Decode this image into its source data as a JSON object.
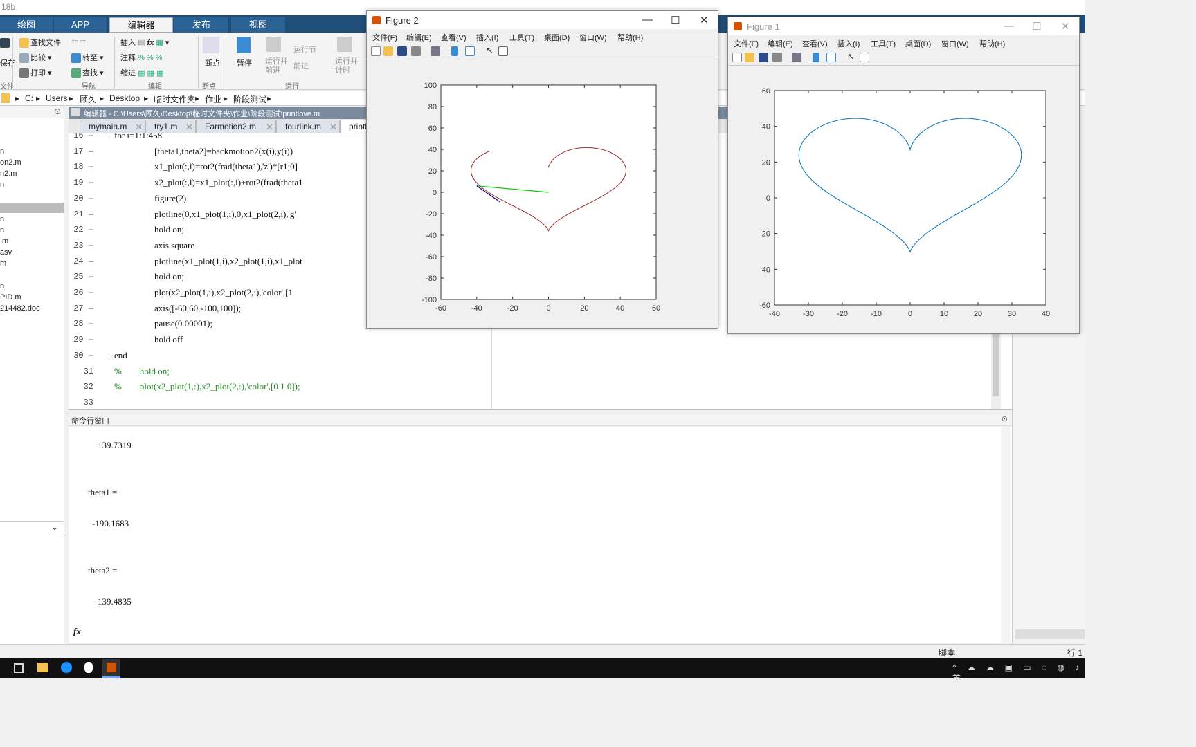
{
  "app": {
    "title_fragment": "18b"
  },
  "ribbon_tabs": [
    "绘图",
    "APP",
    "编辑器",
    "发布",
    "视图"
  ],
  "ribbon": {
    "file_group": {
      "save": "保存",
      "label": "文件"
    },
    "edit": {
      "find_files": "查找文件",
      "compare": "比较",
      "print": "打印",
      "goto": "转至",
      "find": "查找",
      "nav_label": "导航"
    },
    "editor": {
      "insert": "插入",
      "comment": "注释",
      "indent": "缩进",
      "fx": "fx",
      "label": "编辑"
    },
    "breakpoints": {
      "label": "断点",
      "btn": "断点"
    },
    "run": {
      "pause": "暂停",
      "run_advance": "运行并\n前进",
      "run_section": "运行节",
      "advance": "前进",
      "run_time": "运行并\n计时",
      "label": "运行"
    }
  },
  "address": [
    "C:",
    "Users",
    "顾久",
    "Desktop",
    "临时文件夹",
    "作业",
    "阶段测试"
  ],
  "left_files": [
    "n",
    "on2.m",
    "n2.m",
    "n",
    "",
    "n",
    "n",
    ".m",
    "asv",
    "m",
    "",
    "n",
    "PID.m",
    "214482.doc"
  ],
  "editor": {
    "header": "编辑器 - C:\\Users\\顾久\\Desktop\\临时文件夹\\作业\\阶段测试\\printlove.m",
    "tabs": [
      "mymain.m",
      "try1.m",
      "Farmotion2.m",
      "fourlink.m",
      "printlove.m"
    ],
    "lines": [
      {
        "n": "16 —",
        "text": "for i=1:1:458",
        "indent": 0
      },
      {
        "n": "17 —",
        "text": "[theta1,theta2]=backmotion2(x(i),y(i))",
        "indent": 1
      },
      {
        "n": "18 —",
        "text": "x1_plot(:,i)=rot2(frad(theta1),'z')*[r1;0]",
        "indent": 1
      },
      {
        "n": "19 —",
        "text": "x2_plot(:,i)=x1_plot(:,i)+rot2(frad(theta1",
        "indent": 1
      },
      {
        "n": "20 —",
        "text": "figure(2)",
        "indent": 1
      },
      {
        "n": "21 —",
        "text": "plotline(0,x1_plot(1,i),0,x1_plot(2,i),'g'",
        "indent": 1
      },
      {
        "n": "22 —",
        "text": "hold on;",
        "indent": 1
      },
      {
        "n": "23 —",
        "text": "axis square",
        "indent": 1
      },
      {
        "n": "24 —",
        "text": "plotline(x1_plot(1,i),x2_plot(1,i),x1_plot",
        "indent": 1
      },
      {
        "n": "25 —",
        "text": "hold on;",
        "indent": 1
      },
      {
        "n": "26 —",
        "text": "plot(x2_plot(1,:),x2_plot(2,:),'color',[1",
        "indent": 1
      },
      {
        "n": "27 —",
        "text": "axis([-60,60,-100,100]);",
        "indent": 1
      },
      {
        "n": "28 —",
        "text": "pause(0.00001);",
        "indent": 1
      },
      {
        "n": "29 —",
        "text": "hold off",
        "indent": 1
      },
      {
        "n": "30 —",
        "text": "end",
        "indent": 0
      },
      {
        "n": "31",
        "text": "%        hold on;",
        "indent": 0,
        "comment": true
      },
      {
        "n": "32",
        "text": "%        plot(x2_plot(1,:),x2_plot(2,:),'color',[0 1 0]);",
        "indent": 0,
        "comment": true
      },
      {
        "n": "33",
        "text": "",
        "indent": 0
      }
    ]
  },
  "command": {
    "header": "命令行窗口",
    "lines": [
      "139.7319",
      "theta1 =",
      "-190.1683",
      "theta2 =",
      "139.4835"
    ],
    "prompt": "fx"
  },
  "status": {
    "script": "脚本",
    "row": "行 1"
  },
  "figure2": {
    "title": "Figure 2",
    "menus": [
      "文件(F)",
      "编辑(E)",
      "查看(V)",
      "插入(I)",
      "工具(T)",
      "桌面(D)",
      "窗口(W)",
      "帮助(H)"
    ],
    "xticks": [
      "-60",
      "-40",
      "-20",
      "0",
      "20",
      "40",
      "60"
    ],
    "yticks": [
      "100",
      "80",
      "60",
      "40",
      "20",
      "0",
      "-20",
      "-40",
      "-60",
      "-80",
      "-100"
    ]
  },
  "figure1": {
    "title": "Figure 1",
    "menus": [
      "文件(F)",
      "编辑(E)",
      "查看(V)",
      "插入(I)",
      "工具(T)",
      "桌面(D)",
      "窗口(W)",
      "帮助(H)"
    ],
    "xticks": [
      "-40",
      "-30",
      "-20",
      "-10",
      "0",
      "10",
      "20",
      "30",
      "40"
    ],
    "yticks": [
      "60",
      "40",
      "20",
      "0",
      "-20",
      "-40",
      "-60"
    ]
  },
  "chart_data": [
    {
      "type": "line",
      "xlim": [
        -60,
        60
      ],
      "ylim": [
        -100,
        100
      ],
      "series": [
        {
          "color": "#a0262a",
          "shape": "heart",
          "partial": true
        },
        {
          "color": "#00cc00",
          "x": [
            0,
            -40
          ],
          "y": [
            0,
            6
          ]
        },
        {
          "color": "#000080",
          "x": [
            -40,
            -27
          ],
          "y": [
            6,
            -9
          ]
        }
      ]
    },
    {
      "type": "line",
      "xlim": [
        -40,
        40
      ],
      "ylim": [
        -60,
        60
      ],
      "series": [
        {
          "color": "#0072bd",
          "shape": "heart"
        }
      ]
    }
  ]
}
